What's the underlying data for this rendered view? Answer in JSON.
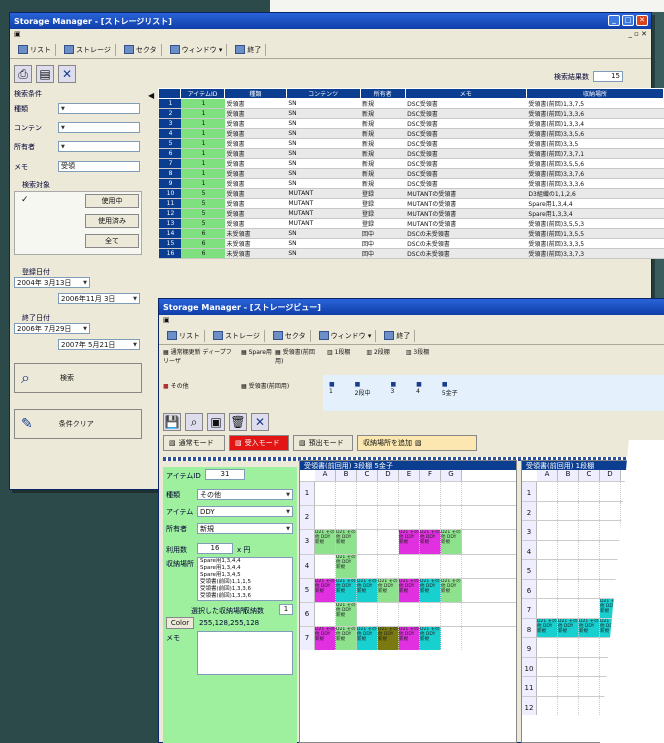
{
  "win1": {
    "title": "Storage Manager - [ストレージリスト]",
    "nav": [
      "リスト",
      "ストレージ",
      "セクタ",
      "ウィンドウ ▾",
      "終了"
    ],
    "result_label": "検索結果数",
    "result_value": "15",
    "search_label": "検索条件",
    "fields": [
      "種類",
      "コンテン",
      "所有者",
      "メモ"
    ],
    "memo_value": "受領",
    "target_label": "検索対象",
    "target_btns": [
      "使用中",
      "使用済み",
      "全て"
    ],
    "date1_label": "登録日付",
    "date1_a": "2004年 3月13日",
    "date1_b": "2006年11月 3日",
    "date2_label": "終了日付",
    "date2_a": "2006年 7月29日",
    "date2_b": "2007年 5月21日",
    "search_btn": "検索",
    "clear_btn": "条件クリア",
    "headers": [
      "",
      "アイテムID",
      "種類",
      "コンテンツ",
      "所有者",
      "メモ",
      "収納場所"
    ],
    "rows": [
      [
        "1",
        "1",
        "受領書",
        "SN",
        "新規",
        "DSC受領書",
        "受領書(前回)1,3,7,5"
      ],
      [
        "2",
        "1",
        "受領書",
        "SN",
        "新規",
        "DSC受領書",
        "受領書(前回)1,3,3,6"
      ],
      [
        "3",
        "1",
        "受領書",
        "SN",
        "新規",
        "DSC受領書",
        "受領書(前回)1,3,3,4"
      ],
      [
        "4",
        "1",
        "受領書",
        "SN",
        "新規",
        "DSC受領書",
        "受領書(前回)3,3,5,6"
      ],
      [
        "5",
        "1",
        "受領書",
        "SN",
        "新規",
        "DSC受領書",
        "受領書(前回)3,3,5"
      ],
      [
        "6",
        "1",
        "受領書",
        "SN",
        "新規",
        "DSC受領書",
        "受領書(前回)7,3,7,1"
      ],
      [
        "7",
        "1",
        "受領書",
        "SN",
        "新規",
        "DSC受領書",
        "受領書(前回)3,5,5,6"
      ],
      [
        "8",
        "1",
        "受領書",
        "SN",
        "新規",
        "DSC受領書",
        "受領書(前回)3,3,7,6"
      ],
      [
        "9",
        "1",
        "受領書",
        "SN",
        "新規",
        "DSC受領書",
        "受領書(前回)3,3,3,6"
      ],
      [
        "10",
        "5",
        "受領書",
        "MUTANT",
        "登録",
        "MUTANTの受領書",
        "D3組織の1,1,2,6"
      ],
      [
        "11",
        "5",
        "受領書",
        "MUTANT",
        "登録",
        "MUTANTの受領書",
        "Spare用1,3,4,4"
      ],
      [
        "12",
        "5",
        "受領書",
        "MUTANT",
        "登録",
        "MUTANTの受領書",
        "Spare用1,3,3,4"
      ],
      [
        "13",
        "5",
        "受領書",
        "MUTANT",
        "登録",
        "MUTANTの受領書",
        "受領書(前回)3,5,5,3"
      ],
      [
        "14",
        "6",
        "未受領書",
        "SN",
        "回中",
        "DSCの未受領書",
        "受領書(前回)1,3,5,5"
      ],
      [
        "15",
        "6",
        "未受領書",
        "SN",
        "回中",
        "DSCの未受領書",
        "受領書(前回)3,3,3,5"
      ],
      [
        "16",
        "6",
        "未受領書",
        "SN",
        "回中",
        "DSCの未受領書",
        "受領書(前回)3,3,7,3"
      ]
    ]
  },
  "win2": {
    "title": "Storage Manager - [ストレージビュー]",
    "nav": [
      "リスト",
      "ストレージ",
      "セクタ",
      "ウィンドウ ▾",
      "終了"
    ],
    "tree": [
      "通常棚更新 ディープフリーザ",
      "Spare用",
      "受領書(前回用)",
      "その他",
      "受領書(前回用)"
    ],
    "slots_top": [
      "1段棚",
      "2段棚",
      "3段棚"
    ],
    "slots_bottom": [
      "1",
      "2段中",
      "3",
      "4",
      "5金子"
    ],
    "modes": [
      "通常モード",
      "受入モード",
      "預出モード"
    ],
    "add_btn": "収納場所を追加",
    "item_id_label": "アイテムID",
    "item_id": "31",
    "kind_label": "種類",
    "kind": "その他",
    "item_label": "アイテム",
    "item": "DDY",
    "owner_label": "所有者",
    "owner": "新規",
    "count_label": "利用数",
    "count": "16",
    "count_unit": "x 円",
    "place_label": "収納場所",
    "places": [
      "Spare用1,3,4,4",
      "Spare用1,3,4,4",
      "Spare用1,3,4,5",
      "受領書(前回)1,1,1,5",
      "受領書(前回)1,3,3,6",
      "受領書(前回)1,3,3,6"
    ],
    "selected_label": "選択した収納場所",
    "num_label": "収納数",
    "num": "1",
    "color_label": "Color",
    "color_value": "255,128,255,128",
    "memo_label": "メモ",
    "stor1_title": "受領書(前回用) 3段棚 5金子",
    "stor2_title": "受領書(前回用) 1段棚",
    "cols": [
      "A",
      "B",
      "C",
      "D",
      "E",
      "F",
      "G"
    ],
    "cols2": [
      "A",
      "B",
      "C",
      "D"
    ],
    "rows": [
      "1",
      "2",
      "3",
      "4",
      "5",
      "6",
      "7"
    ],
    "rows2": [
      "1",
      "2",
      "3",
      "4",
      "5",
      "6",
      "7",
      "8",
      "9",
      "10",
      "11",
      "12"
    ],
    "cell_text": "D21 その他 DDY 新規"
  }
}
